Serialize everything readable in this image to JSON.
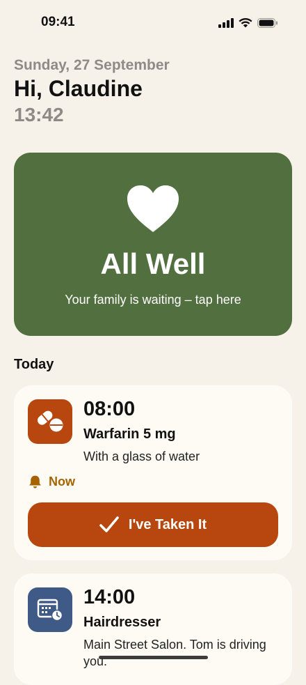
{
  "status_bar": {
    "time": "09:41"
  },
  "header": {
    "date": "Sunday, 27 September",
    "greeting": "Hi, Claudine",
    "clock": "13:42"
  },
  "hero": {
    "icon": "heart-icon",
    "title": "All Well",
    "subtitle": "Your family is waiting – tap here",
    "color": "#52703F"
  },
  "today": {
    "section_title": "Today",
    "items": [
      {
        "icon": "pills-icon",
        "time": "08:00",
        "title": "Warfarin 5 mg",
        "subtitle": "With a glass of water",
        "status": "Now",
        "action_label": "I've Taken It",
        "accent": "#B8470F"
      },
      {
        "icon": "calendar-clock-icon",
        "time": "14:00",
        "title": "Hairdresser",
        "subtitle": "Main Street Salon. Tom is driving you.",
        "accent": "#3F5A86"
      }
    ]
  }
}
